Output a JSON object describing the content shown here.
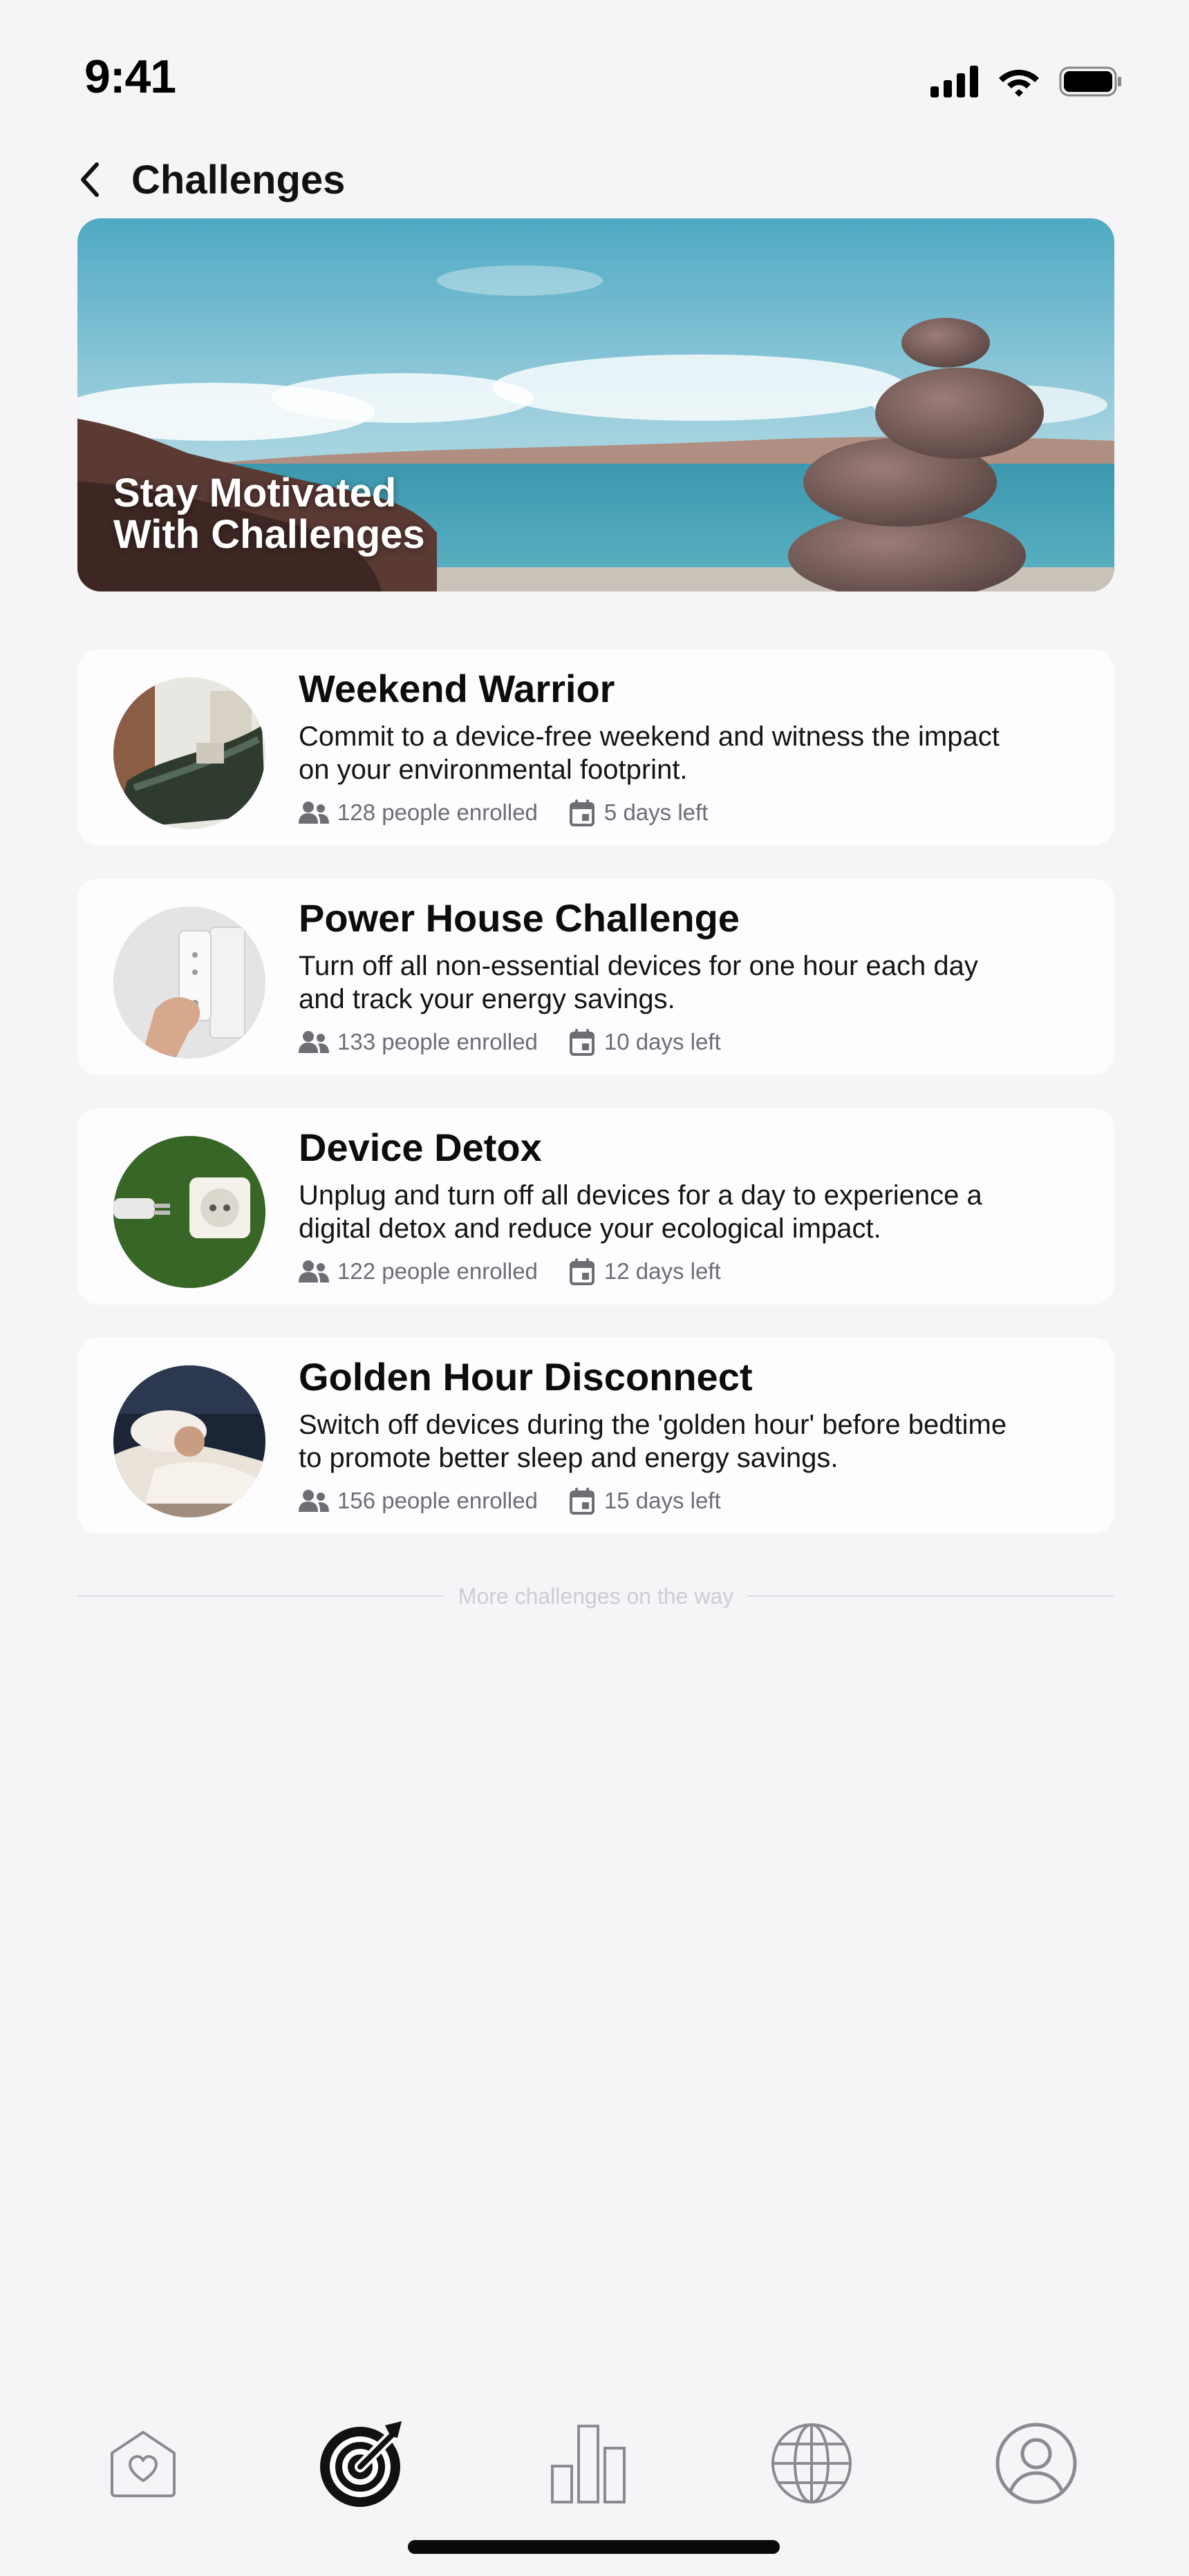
{
  "status_bar": {
    "time": "9:41"
  },
  "header": {
    "title": "Challenges"
  },
  "hero": {
    "text": "Stay Motivated\nWith Challenges"
  },
  "challenges": [
    {
      "title": "Weekend Warrior",
      "description": "Commit to a device-free weekend and witness the impact on your environmental footprint.",
      "enrolled": "128 people enrolled",
      "days_left": "5 days left"
    },
    {
      "title": "Power House Challenge",
      "description": "Turn off all non-essential devices for one hour each day and track your energy savings.",
      "enrolled": "133 people enrolled",
      "days_left": "10 days left"
    },
    {
      "title": "Device Detox",
      "description": "Unplug and turn off all devices for a day to experience a digital detox and reduce your ecological impact.",
      "enrolled": "122 people enrolled",
      "days_left": "12 days left"
    },
    {
      "title": "Golden Hour Disconnect",
      "description": "Switch off devices during the 'golden hour' before bedtime to promote better sleep and energy savings.",
      "enrolled": "156 people enrolled",
      "days_left": "15 days left"
    }
  ],
  "footer_note": "More challenges on the way",
  "tab_bar": {
    "tabs": [
      {
        "icon": "home-heart-icon",
        "active": false
      },
      {
        "icon": "target-icon",
        "active": true
      },
      {
        "icon": "bar-chart-icon",
        "active": false
      },
      {
        "icon": "globe-icon",
        "active": false
      },
      {
        "icon": "profile-icon",
        "active": false
      }
    ]
  },
  "colors": {
    "background": "#f5f5f8",
    "card": "#fdfdff",
    "text": "#111111",
    "muted": "#6d6d72",
    "active_tab": "#111111",
    "inactive_tab": "#8a8a8f"
  }
}
